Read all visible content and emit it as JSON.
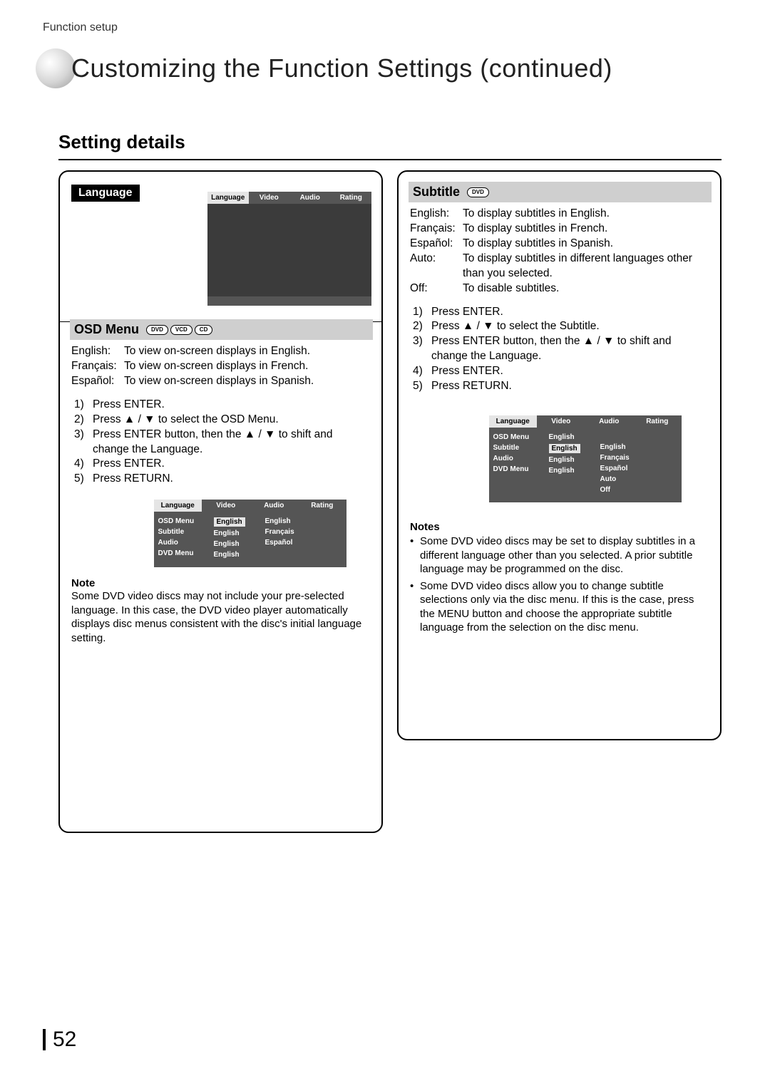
{
  "breadcrumb": "Function setup",
  "page_title": "Customizing the Function Settings (continued)",
  "section_title": "Setting details",
  "page_number": "52",
  "glyphs": {
    "up": "▲",
    "down": "▼",
    "bullet": "•"
  },
  "left": {
    "tag": "Language",
    "osd1_tabs": [
      "Language",
      "Video",
      "Audio",
      "Rating"
    ],
    "osd1_selected": 0,
    "heading": "OSD Menu",
    "heading_badges": [
      "DVD",
      "VCD",
      "CD"
    ],
    "defs": [
      {
        "k": "English:",
        "v": "To view on-screen displays in English."
      },
      {
        "k": "Français:",
        "v": "To view on-screen displays in French."
      },
      {
        "k": "Español:",
        "v": "To view on-screen displays in Spanish."
      }
    ],
    "steps": [
      {
        "n": "1)",
        "t": "Press ENTER."
      },
      {
        "n": "2)",
        "t": "Press ▲ / ▼ to select the OSD Menu."
      },
      {
        "n": "3)",
        "t": "Press ENTER button, then the ▲ / ▼ to shift and change the Language."
      },
      {
        "n": "4)",
        "t": "Press ENTER."
      },
      {
        "n": "5)",
        "t": "Press RETURN."
      }
    ],
    "osd2": {
      "tabs": [
        "Language",
        "Video",
        "Audio",
        "Rating"
      ],
      "selected": 0,
      "rows": [
        "OSD Menu",
        "Subtitle",
        "Audio",
        "DVD Menu"
      ],
      "vals": [
        "English",
        "English",
        "English",
        "English"
      ],
      "opts": [
        "English",
        "Français",
        "Español"
      ],
      "highlight_row": 0
    },
    "note_h": "Note",
    "note_b": "Some DVD video discs may not include your pre-selected language. In this case, the DVD video player automatically displays disc menus consistent with the disc's initial language setting."
  },
  "right": {
    "heading": "Subtitle",
    "heading_badges": [
      "DVD"
    ],
    "defs": [
      {
        "k": "English:",
        "v": "To display subtitles in English."
      },
      {
        "k": "Français:",
        "v": "To display subtitles in French."
      },
      {
        "k": "Español:",
        "v": "To display subtitles in Spanish."
      },
      {
        "k": "Auto:",
        "v": "To display subtitles in different languages other than you selected."
      },
      {
        "k": "Off:",
        "v": "To disable subtitles."
      }
    ],
    "steps": [
      {
        "n": "1)",
        "t": "Press ENTER."
      },
      {
        "n": "2)",
        "t": "Press ▲ / ▼ to select the Subtitle."
      },
      {
        "n": "3)",
        "t": "Press ENTER button, then the ▲ / ▼ to shift and change the Language."
      },
      {
        "n": "4)",
        "t": "Press ENTER."
      },
      {
        "n": "5)",
        "t": "Press RETURN."
      }
    ],
    "osd": {
      "tabs": [
        "Language",
        "Video",
        "Audio",
        "Rating"
      ],
      "selected": 0,
      "rows": [
        "OSD Menu",
        "Subtitle",
        "Audio",
        "DVD Menu"
      ],
      "vals": [
        "English",
        "English",
        "English",
        "English"
      ],
      "opts": [
        "English",
        "Français",
        "Español",
        "Auto",
        "Off"
      ],
      "highlight_row": 1
    },
    "note_h": "Notes",
    "bullets": [
      "Some DVD video discs may be set to display subtitles in a different language other than you selected. A prior subtitle language may be programmed on the disc.",
      "Some DVD video discs allow you to change subtitle selections only via the disc menu. If this is the case, press the MENU button and choose the appropriate subtitle language from the selection on the disc menu."
    ]
  }
}
